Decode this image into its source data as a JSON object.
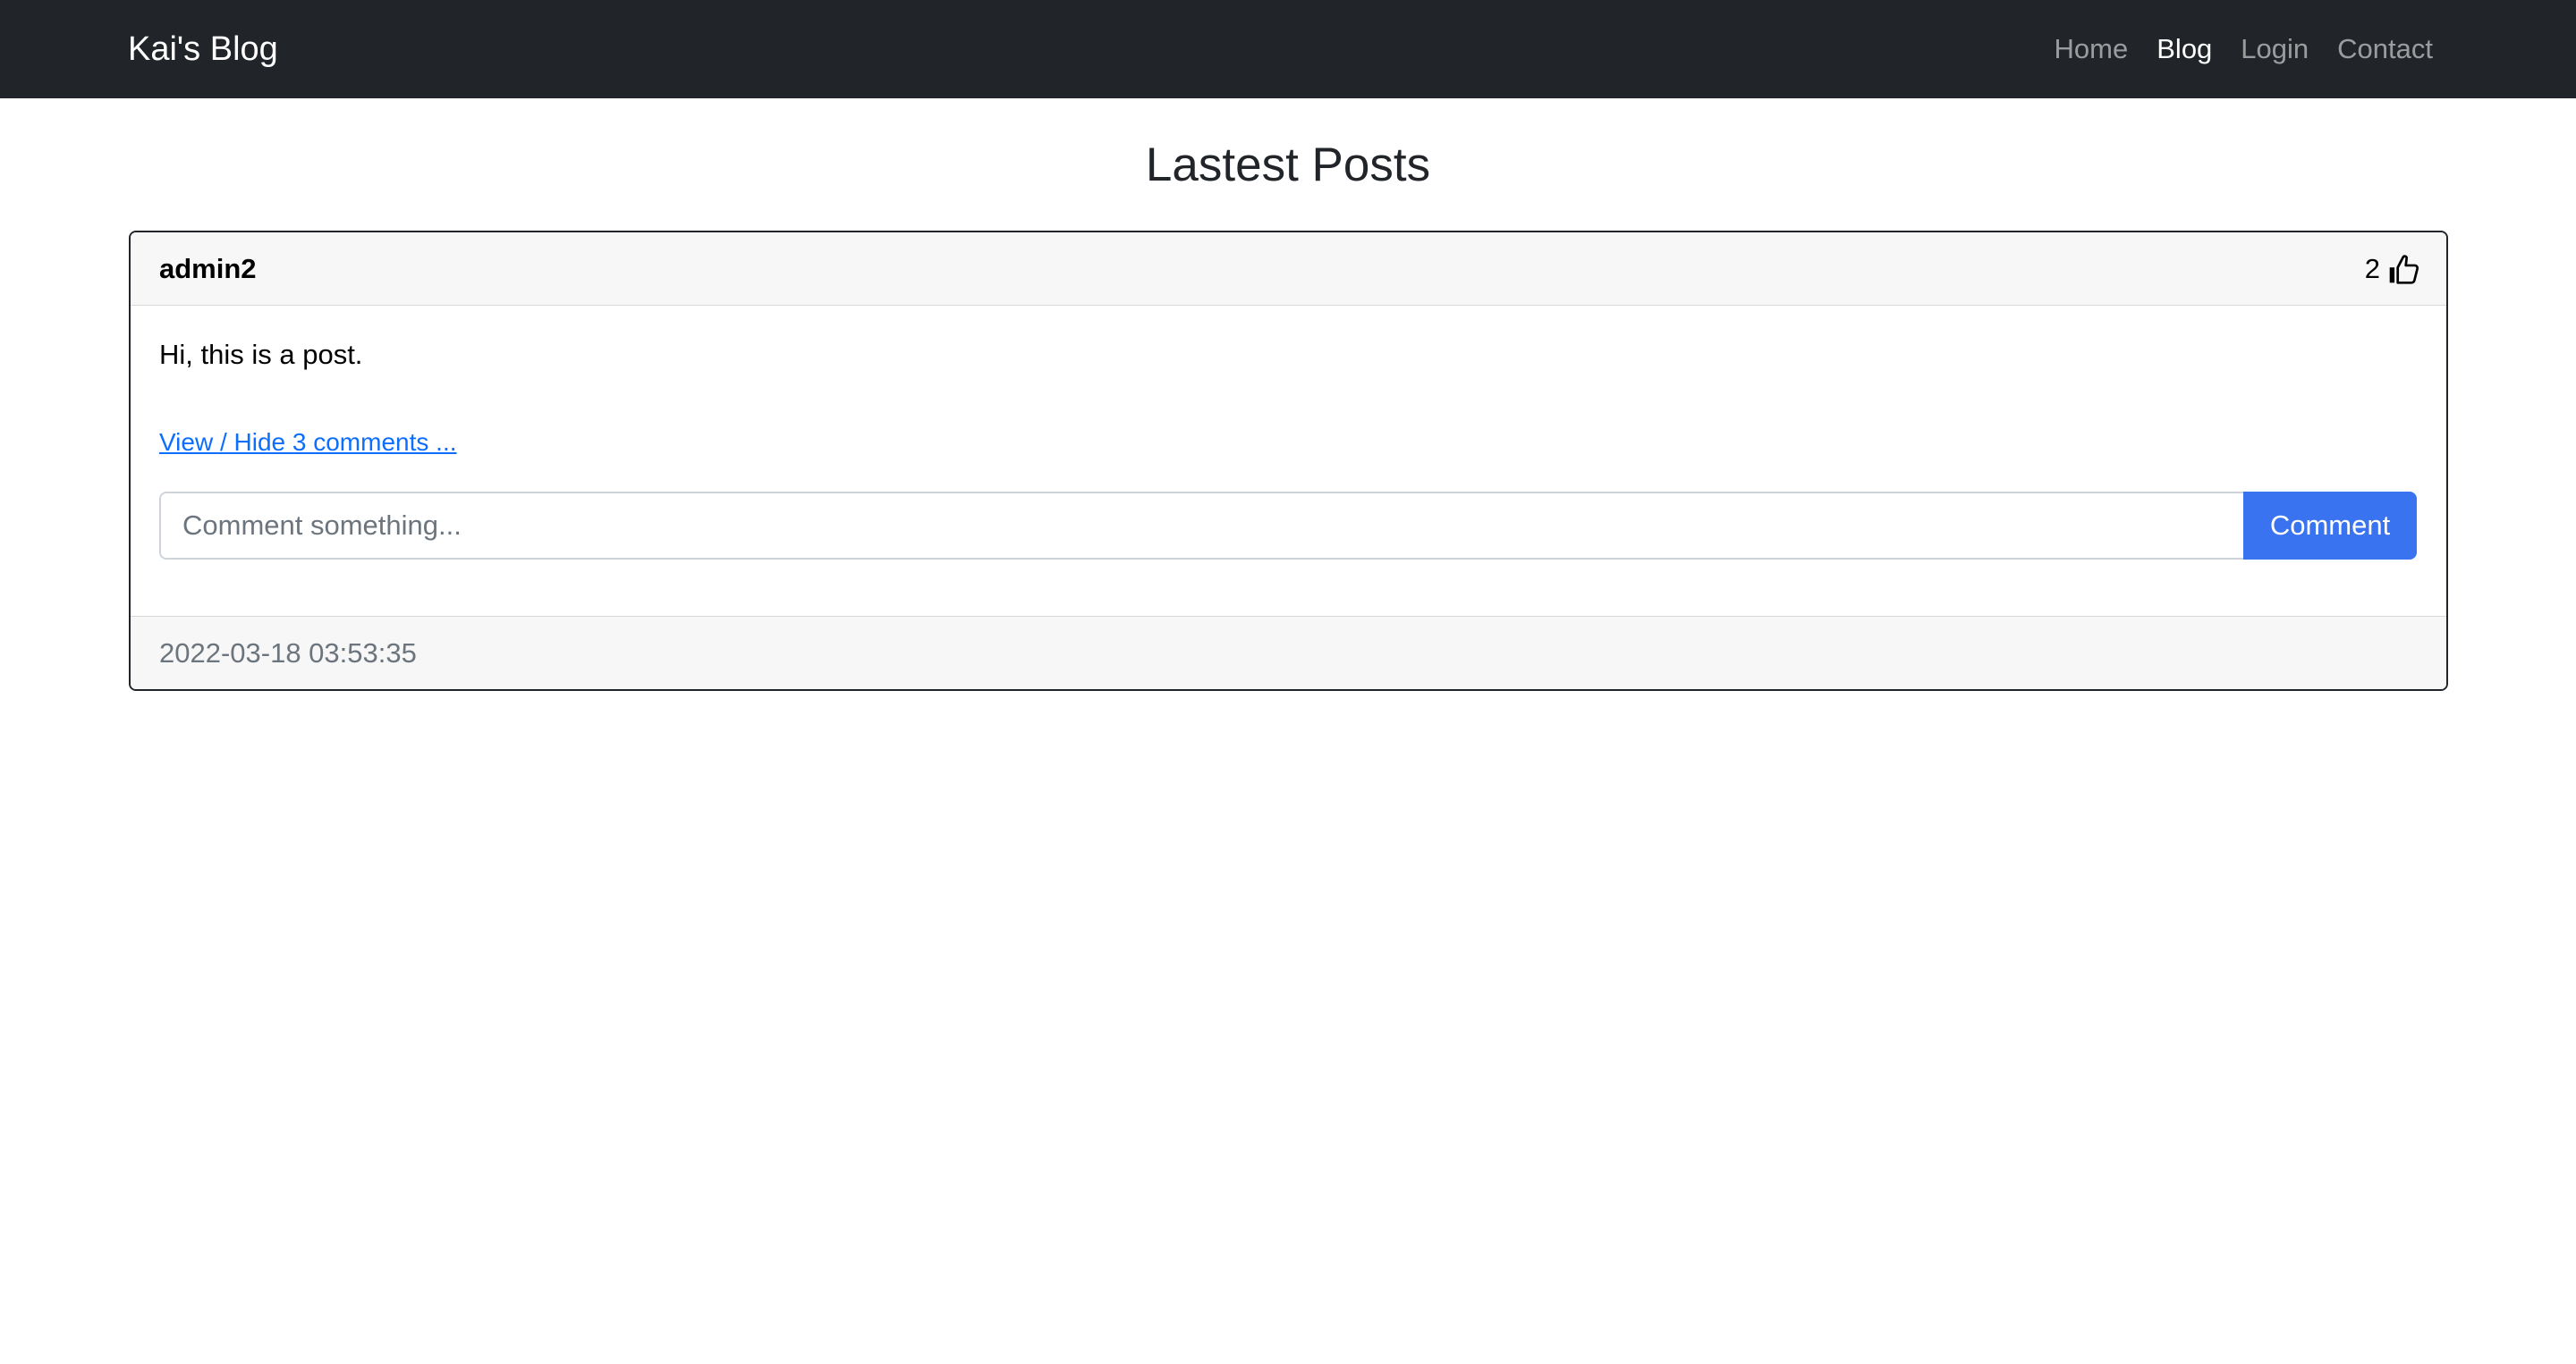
{
  "navbar": {
    "brand": "Kai's Blog",
    "links": [
      {
        "label": "Home",
        "active": false
      },
      {
        "label": "Blog",
        "active": true
      },
      {
        "label": "Login",
        "active": false
      },
      {
        "label": "Contact",
        "active": false
      }
    ]
  },
  "page": {
    "title": "Lastest Posts"
  },
  "posts": [
    {
      "author": "admin2",
      "likes": "2",
      "like_icon": "thumbs-up-icon",
      "body": "Hi, this is a post.",
      "comments_link": "View / Hide 3 comments ...",
      "comment_placeholder": "Comment something...",
      "comment_value": "",
      "comment_button": "Comment",
      "timestamp": "2022-03-18 03:53:35"
    }
  ],
  "colors": {
    "navbar_bg": "#212529",
    "accent": "#3a73f0",
    "link": "#0d6efd",
    "muted": "#6c757d"
  }
}
